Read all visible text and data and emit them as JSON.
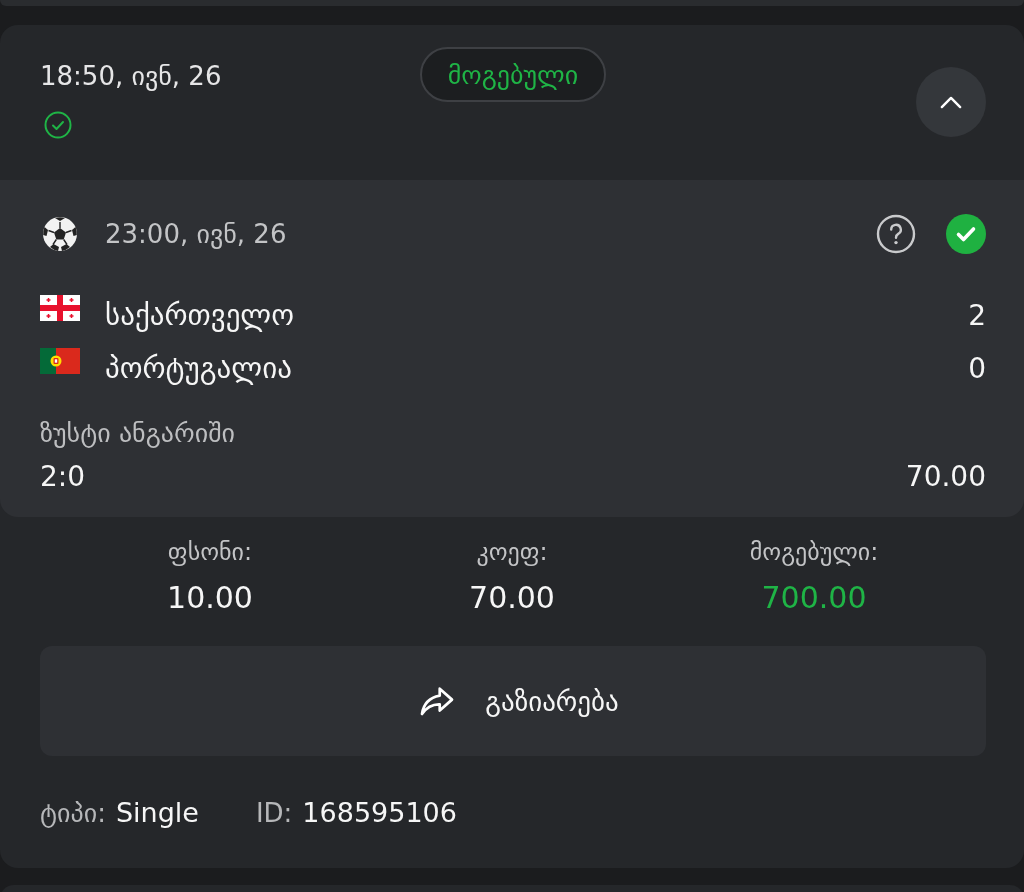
{
  "bet": {
    "placed_at": "18:50, ივნ, 26",
    "status": {
      "label": "მოგებული",
      "won": true
    },
    "expanded": true
  },
  "event": {
    "start_time": "23:00, ივნ, 26",
    "won": true,
    "teams": [
      {
        "name": "საქართველო",
        "score": "2"
      },
      {
        "name": "პორტუგალია",
        "score": "0"
      }
    ],
    "market": "ზუსტი ანგარიში",
    "pick": "2:0",
    "odds": "70.00"
  },
  "summary": [
    {
      "label": "ფსონი:",
      "value": "10.00",
      "kind": "stake"
    },
    {
      "label": "კოეფ:",
      "value": "70.00",
      "kind": "odds"
    },
    {
      "label": "მოგებული:",
      "value": "700.00",
      "kind": "payout"
    }
  ],
  "share_button": {
    "label": "გაზიარება"
  },
  "details": [
    {
      "label": "ტიპი:",
      "value": "Single"
    },
    {
      "label": "ID:",
      "value": "168595106"
    }
  ]
}
